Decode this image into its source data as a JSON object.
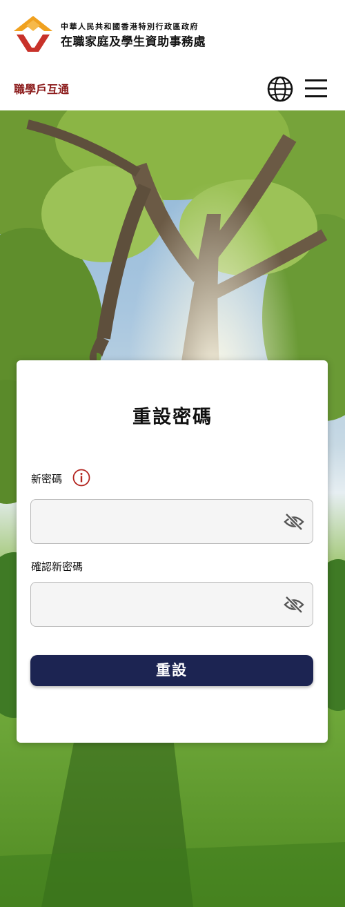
{
  "header": {
    "gov_name": "中華人民共和國香港特別行政區政府",
    "agency_name": "在職家庭及學生資助事務處",
    "portal_link": "職學戶互通"
  },
  "icons": {
    "language": "globe-icon",
    "menu": "hamburger-menu-icon",
    "info": "info-icon",
    "password_toggle": "eye-off-icon"
  },
  "form": {
    "title": "重設密碼",
    "new_password": {
      "label": "新密碼",
      "value": ""
    },
    "confirm_password": {
      "label": "確認新密碼",
      "value": ""
    },
    "submit_label": "重設"
  },
  "colors": {
    "brand_red": "#8b1a1a",
    "button_navy": "#1c2452",
    "logo_orange": "#f0a11f",
    "logo_red": "#c8322a"
  }
}
